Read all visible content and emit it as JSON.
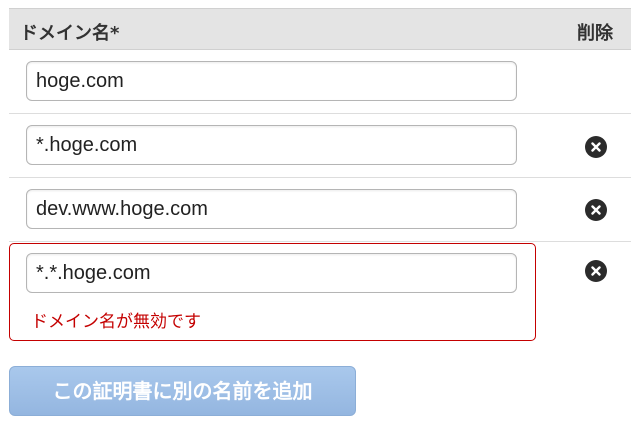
{
  "table": {
    "header": {
      "domain_name_label": "ドメイン名*",
      "delete_label": "削除"
    },
    "rows": [
      {
        "value": "hoge.com",
        "deletable": false
      },
      {
        "value": "*.hoge.com",
        "deletable": true
      },
      {
        "value": "dev.www.hoge.com",
        "deletable": true
      },
      {
        "value": "*.*.hoge.com",
        "deletable": true,
        "error": "ドメイン名が無効です"
      }
    ]
  },
  "actions": {
    "add_button_label": "この証明書に別の名前を追加"
  },
  "icons": {
    "delete": "close-circle-icon"
  },
  "colors": {
    "error": "#c40000",
    "button_bg": "#9dbde6",
    "header_bg": "#e4e4e4"
  }
}
